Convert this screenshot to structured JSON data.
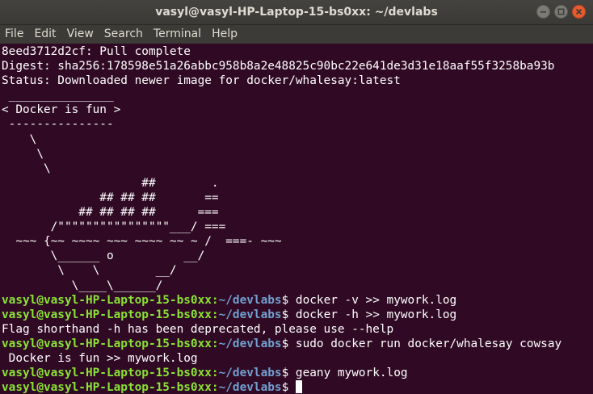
{
  "window": {
    "title": "vasyl@vasyl-HP-Laptop-15-bs0xx: ~/devlabs",
    "controls": [
      "minimize-icon",
      "maximize-icon",
      "close-icon"
    ]
  },
  "menu": [
    "File",
    "Edit",
    "View",
    "Search",
    "Terminal",
    "Help"
  ],
  "colors": {
    "background": "#300a24",
    "prompt_user": "#8ae234",
    "prompt_path": "#729fcf",
    "text": "#ffffff"
  },
  "terminal": {
    "lines": [
      {
        "type": "output",
        "text": "8eed3712d2cf: Pull complete"
      },
      {
        "type": "output",
        "text": "Digest: sha256:178598e51a26abbc958b8a2e48825c90bc22e641de3d31e18aaf55f3258ba93b"
      },
      {
        "type": "output",
        "text": "Status: Downloaded newer image for docker/whalesay:latest"
      },
      {
        "type": "output",
        "text": " _______________ "
      },
      {
        "type": "output",
        "text": "< Docker is fun >"
      },
      {
        "type": "output",
        "text": " --------------- "
      },
      {
        "type": "output",
        "text": "    \\"
      },
      {
        "type": "output",
        "text": "     \\"
      },
      {
        "type": "output",
        "text": "      \\"
      },
      {
        "type": "output",
        "text": "                    ##        ."
      },
      {
        "type": "output",
        "text": "              ## ## ##       =="
      },
      {
        "type": "output",
        "text": "           ## ## ## ##      ==="
      },
      {
        "type": "output",
        "text": "       /\"\"\"\"\"\"\"\"\"\"\"\"\"\"\"\"___/ ==="
      },
      {
        "type": "output",
        "text": "  ~~~ {~~ ~~~~ ~~~ ~~~~ ~~ ~ /  ===- ~~~"
      },
      {
        "type": "output",
        "text": "       \\______ o          __/"
      },
      {
        "type": "output",
        "text": "        \\    \\        __/"
      },
      {
        "type": "output",
        "text": "          \\____\\______/"
      },
      {
        "type": "prompt",
        "user": "vasyl@vasyl-HP-Laptop-15-bs0xx",
        "path": "~/devlabs",
        "command": " docker -v >> mywork.log"
      },
      {
        "type": "prompt",
        "user": "vasyl@vasyl-HP-Laptop-15-bs0xx",
        "path": "~/devlabs",
        "command": " docker -h >> mywork.log"
      },
      {
        "type": "output",
        "text": "Flag shorthand -h has been deprecated, please use --help"
      },
      {
        "type": "prompt",
        "user": "vasyl@vasyl-HP-Laptop-15-bs0xx",
        "path": "~/devlabs",
        "command": " sudo docker run docker/whalesay cowsay"
      },
      {
        "type": "output",
        "text": " Docker is fun >> mywork.log"
      },
      {
        "type": "prompt",
        "user": "vasyl@vasyl-HP-Laptop-15-bs0xx",
        "path": "~/devlabs",
        "command": " geany mywork.log"
      },
      {
        "type": "prompt",
        "user": "vasyl@vasyl-HP-Laptop-15-bs0xx",
        "path": "~/devlabs",
        "command": " ",
        "cursor": true
      }
    ]
  }
}
